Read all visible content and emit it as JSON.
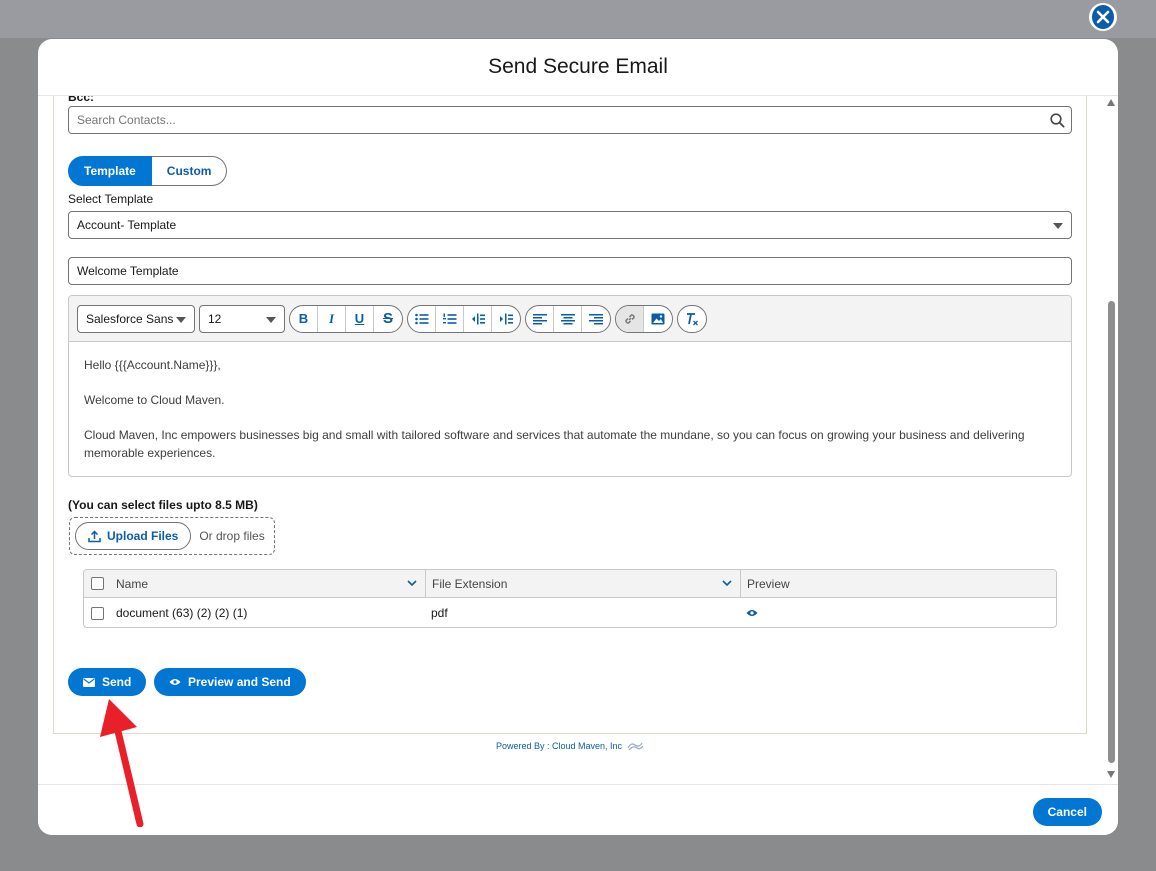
{
  "modal": {
    "title": "Send Secure Email"
  },
  "bcc": {
    "label": "Bcc:",
    "search_placeholder": "Search Contacts..."
  },
  "mode_toggle": {
    "template_label": "Template",
    "custom_label": "Custom",
    "active": "Template"
  },
  "template_select": {
    "label": "Select Template",
    "value": "Account- Template"
  },
  "subject": {
    "value": "Welcome Template"
  },
  "editor": {
    "font_family": "Salesforce Sans",
    "font_size": "12",
    "body": [
      "Hello {{{Account.Name}}},",
      "Welcome to Cloud Maven.",
      "Cloud Maven, Inc empowers businesses big and small with tailored software and services that automate the mundane, so you can focus on growing your business and delivering memorable experiences."
    ]
  },
  "upload": {
    "limit_text": "(You can select files upto 8.5 MB)",
    "button_label": "Upload Files",
    "drop_text": "Or drop files"
  },
  "file_table": {
    "columns": [
      "Name",
      "File Extension",
      "Preview"
    ],
    "rows": [
      {
        "name": "document (63) (2) (2) (1)",
        "extension": "pdf"
      }
    ]
  },
  "actions": {
    "send_label": "Send",
    "preview_send_label": "Preview and Send",
    "cancel_label": "Cancel"
  },
  "footer": {
    "powered_by": "Powered By : Cloud Maven, Inc"
  },
  "colors": {
    "brand": "#0176d3",
    "arrow": "#e8202a"
  }
}
